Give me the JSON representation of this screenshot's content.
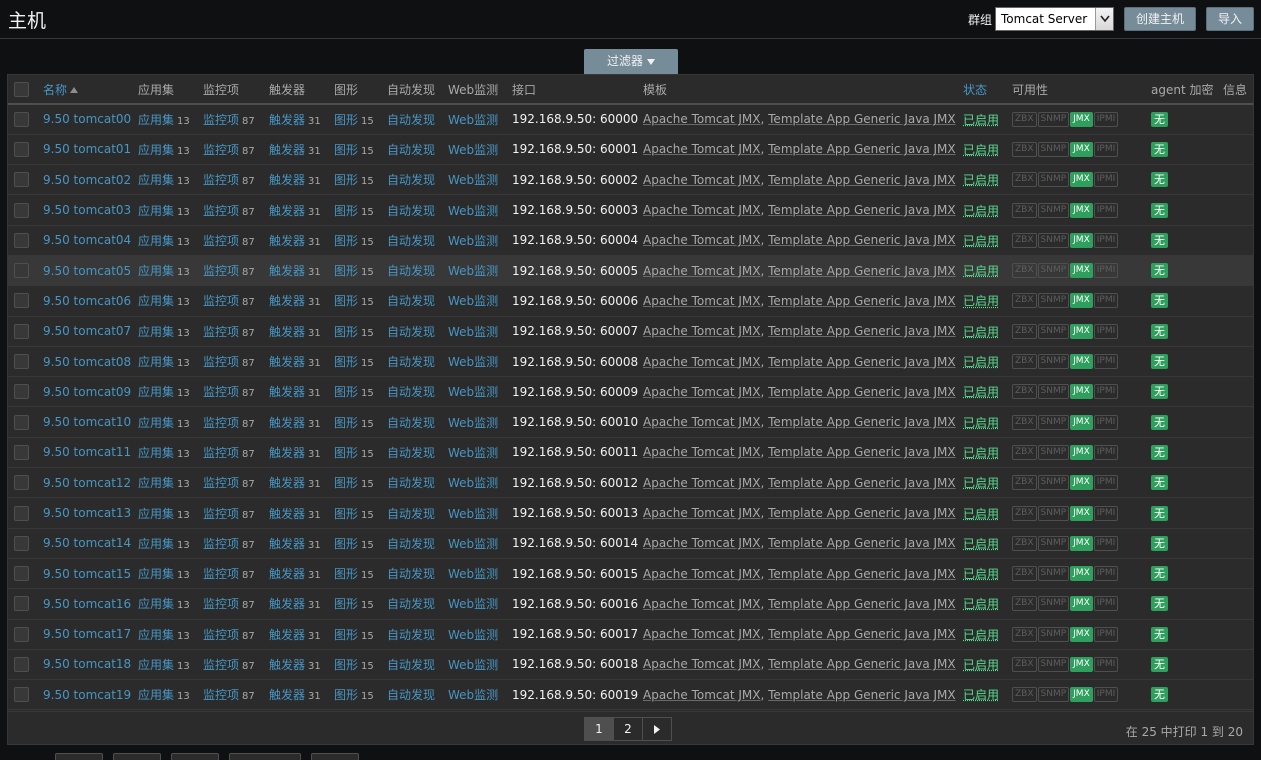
{
  "page": {
    "title": "主机"
  },
  "filter": {
    "group_label": "群组",
    "group_value": "Tomcat Server",
    "tab_label": "过滤器"
  },
  "actions": {
    "create_host": "创建主机",
    "import": "导入"
  },
  "columns": {
    "name": "名称",
    "applications": "应用集",
    "items": "监控项",
    "triggers": "触发器",
    "graphs": "图形",
    "discovery": "自动发现",
    "web": "Web监测",
    "interface": "接口",
    "templates": "模板",
    "status": "状态",
    "availability": "可用性",
    "encryption": "agent 加密",
    "info": "信息"
  },
  "row_labels": {
    "applications": "应用集",
    "items": "监控项",
    "triggers": "触发器",
    "graphs": "图形",
    "discovery": "自动发现",
    "web": "Web监测",
    "status": "已启用",
    "badge_zbx": "ZBX",
    "badge_snmp": "SNMP",
    "badge_jmx": "JMX",
    "badge_ipmi": "IPMI",
    "encryption": "无",
    "template_1": "Apache Tomcat JMX",
    "template_sep": ", ",
    "template_2": "Template App Generic Java JMX"
  },
  "counts": {
    "applications": "13",
    "items": "87",
    "triggers": "31",
    "graphs": "15"
  },
  "hosts": [
    {
      "name": "9.50 tomcat00",
      "interface": "192.168.9.50: 60000"
    },
    {
      "name": "9.50 tomcat01",
      "interface": "192.168.9.50: 60001"
    },
    {
      "name": "9.50 tomcat02",
      "interface": "192.168.9.50: 60002"
    },
    {
      "name": "9.50 tomcat03",
      "interface": "192.168.9.50: 60003"
    },
    {
      "name": "9.50 tomcat04",
      "interface": "192.168.9.50: 60004"
    },
    {
      "name": "9.50 tomcat05",
      "interface": "192.168.9.50: 60005"
    },
    {
      "name": "9.50 tomcat06",
      "interface": "192.168.9.50: 60006"
    },
    {
      "name": "9.50 tomcat07",
      "interface": "192.168.9.50: 60007"
    },
    {
      "name": "9.50 tomcat08",
      "interface": "192.168.9.50: 60008"
    },
    {
      "name": "9.50 tomcat09",
      "interface": "192.168.9.50: 60009"
    },
    {
      "name": "9.50 tomcat10",
      "interface": "192.168.9.50: 60010"
    },
    {
      "name": "9.50 tomcat11",
      "interface": "192.168.9.50: 60011"
    },
    {
      "name": "9.50 tomcat12",
      "interface": "192.168.9.50: 60012"
    },
    {
      "name": "9.50 tomcat13",
      "interface": "192.168.9.50: 60013"
    },
    {
      "name": "9.50 tomcat14",
      "interface": "192.168.9.50: 60014"
    },
    {
      "name": "9.50 tomcat15",
      "interface": "192.168.9.50: 60015"
    },
    {
      "name": "9.50 tomcat16",
      "interface": "192.168.9.50: 60016"
    },
    {
      "name": "9.50 tomcat17",
      "interface": "192.168.9.50: 60017"
    },
    {
      "name": "9.50 tomcat18",
      "interface": "192.168.9.50: 60018"
    },
    {
      "name": "9.50 tomcat19",
      "interface": "192.168.9.50: 60019"
    }
  ],
  "pagination": {
    "pages": [
      "1",
      "2"
    ],
    "current": "1",
    "next_icon": "play-right-icon",
    "info": "在 25 中打印 1 到 20"
  },
  "colors": {
    "background": "#0e1012",
    "panel": "#2b2b2b",
    "link": "#4796c4",
    "enabled": "#59db8f",
    "badge_green": "#2f9f5e",
    "button": "#768d99"
  }
}
